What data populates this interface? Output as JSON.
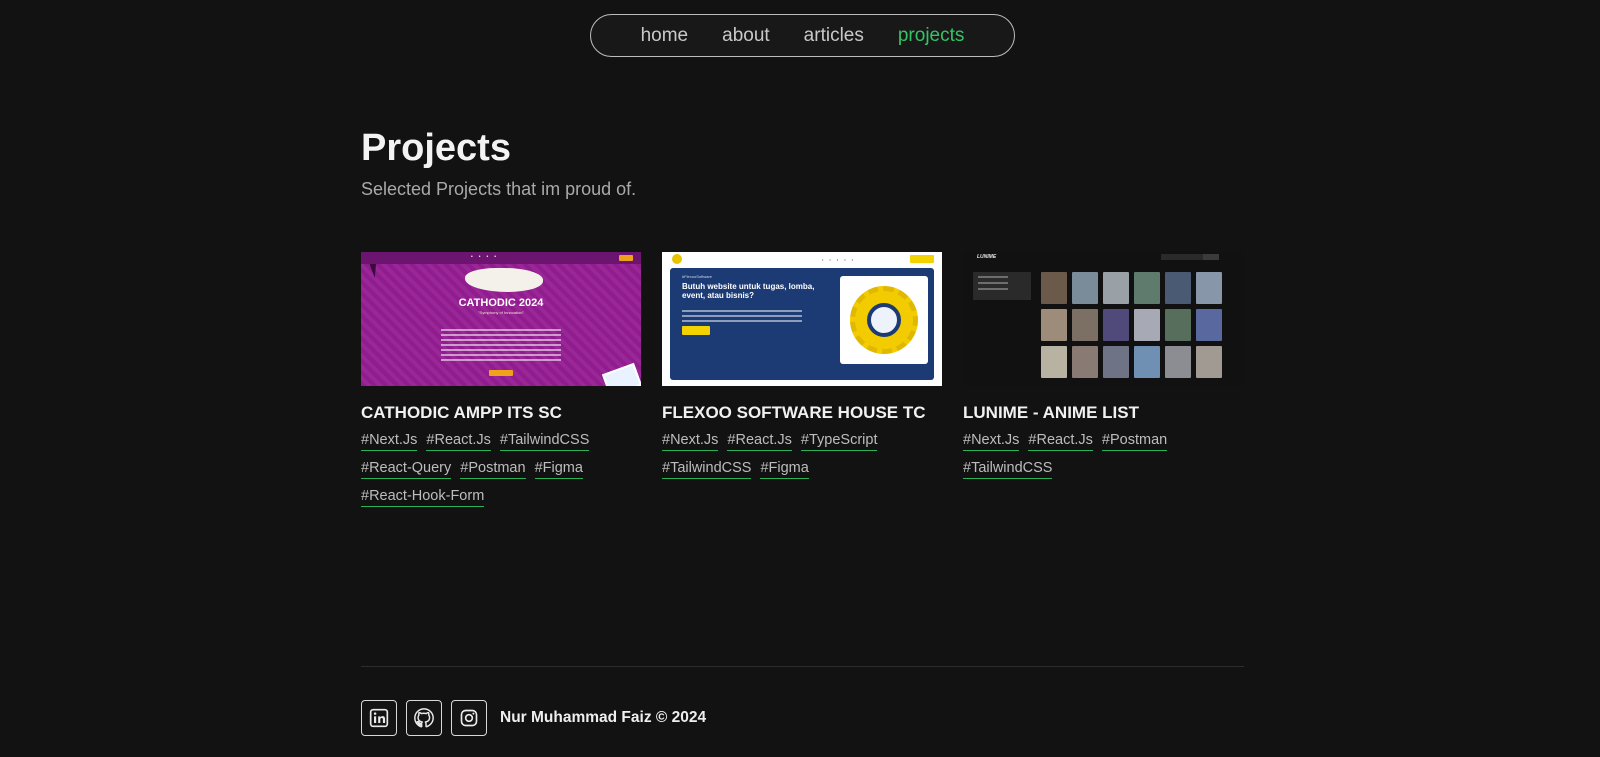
{
  "nav": {
    "items": [
      {
        "label": "home",
        "active": false
      },
      {
        "label": "about",
        "active": false
      },
      {
        "label": "articles",
        "active": false
      },
      {
        "label": "projects",
        "active": true
      }
    ],
    "accent_color": "#36c267"
  },
  "header": {
    "title": "Projects",
    "subtitle": "Selected Projects that im proud of."
  },
  "projects": [
    {
      "title": "CATHODIC AMPP ITS SC",
      "thumbnail": {
        "theme_color": "#8f1d8e",
        "headline": "CATHODIC 2024"
      },
      "tags": [
        "#Next.Js",
        "#React.Js",
        "#TailwindCSS",
        "#React-Query",
        "#Postman",
        "#Figma",
        "#React-Hook-Form"
      ]
    },
    {
      "title": "FLEXOO SOFTWARE HOUSE TC",
      "thumbnail": {
        "theme_color": "#1c3a73",
        "headline": "Butuh website untuk tugas, lomba, event, atau bisnis?"
      },
      "tags": [
        "#Next.Js",
        "#React.Js",
        "#TypeScript",
        "#TailwindCSS",
        "#Figma"
      ]
    },
    {
      "title": "LUNIME - ANIME LIST",
      "thumbnail": {
        "theme_color": "#111111",
        "headline": "LUNIME"
      },
      "tags": [
        "#Next.Js",
        "#React.Js",
        "#Postman",
        "#TailwindCSS"
      ]
    }
  ],
  "footer": {
    "socials": [
      {
        "icon": "linkedin-icon"
      },
      {
        "icon": "github-icon"
      },
      {
        "icon": "instagram-icon"
      }
    ],
    "copyright": "Nur Muhammad Faiz © 2024"
  }
}
